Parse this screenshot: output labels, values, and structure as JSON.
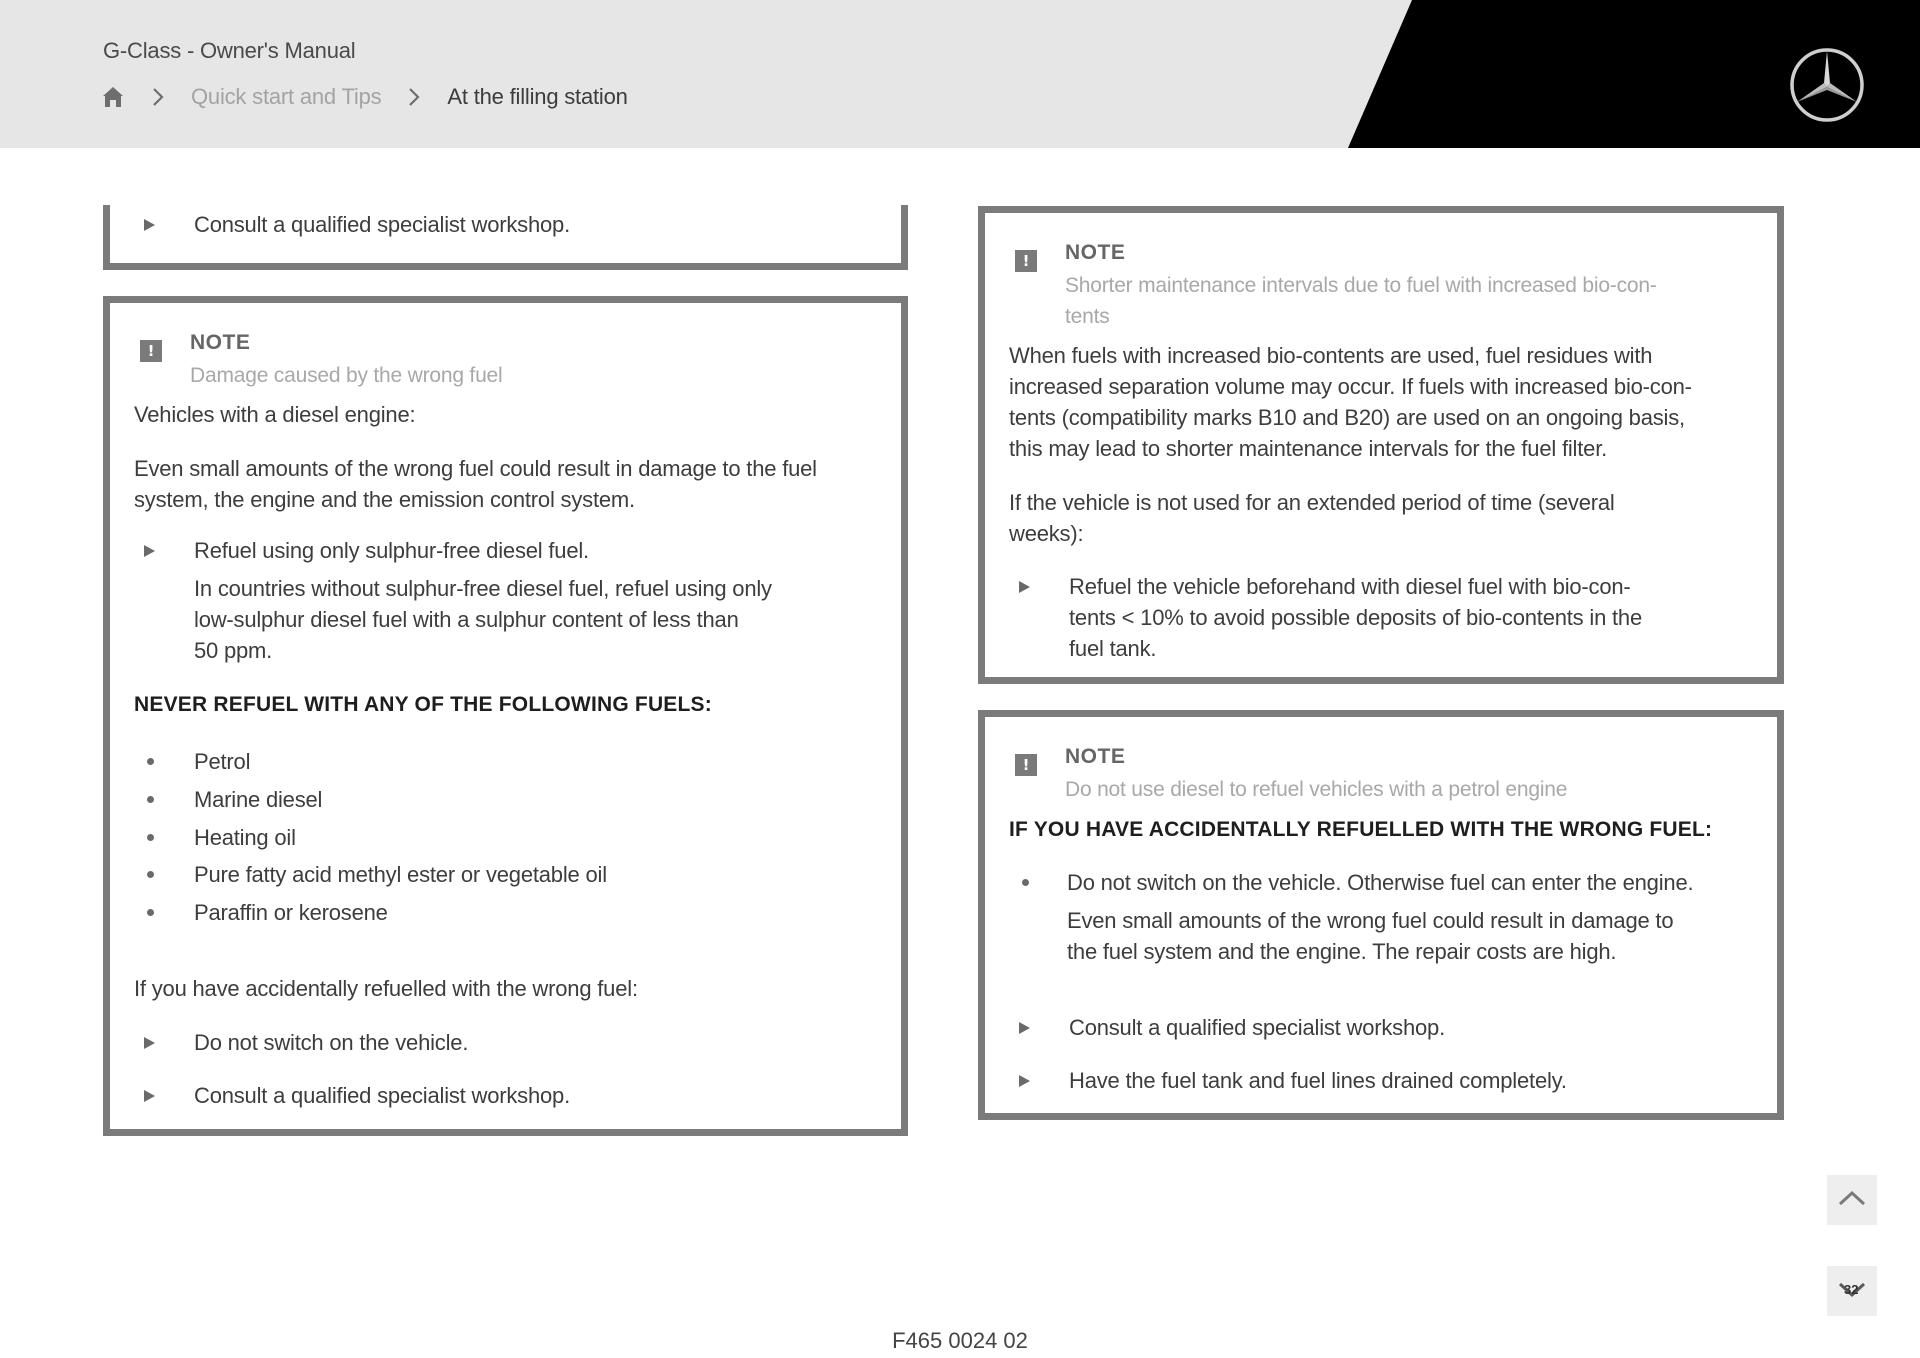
{
  "header": {
    "doc_title": "G-Class - Owner's Manual",
    "breadcrumb": {
      "home_icon": "home-icon",
      "separator_icon": "chevron-right-icon",
      "items": [
        "Quick start and Tips",
        "At the filling station"
      ]
    },
    "logo": "mercedes-star-icon"
  },
  "left_column": {
    "partial_box": {
      "steps": [
        "Consult a qualified specialist workshop."
      ]
    },
    "note_box": {
      "label": "NOTE",
      "subtitle": "Damage caused by the wrong fuel",
      "intro": "Vehicles with a diesel engine:",
      "paragraph": [
        "Even small amounts of the wrong fuel could result in damage to the fuel",
        "system, the engine and the emission control system."
      ],
      "step1": {
        "text": "Refuel using only sulphur-free diesel fuel.",
        "detail": [
          "In countries without sulphur-free diesel fuel, refuel using only",
          "low-sulphur diesel fuel with a sulphur content of less than",
          "50 ppm."
        ]
      },
      "heading": "NEVER REFUEL WITH ANY OF THE FOLLOWING FUELS:",
      "fuels": [
        "Petrol",
        "Marine diesel",
        "Heating oil",
        "Pure fatty acid methyl ester or vegetable oil",
        "Paraffin or kerosene"
      ],
      "if_wrong": "If you have accidentally refuelled with the wrong fuel:",
      "steps": [
        "Do not switch on the vehicle.",
        "Consult a qualified specialist workshop."
      ]
    }
  },
  "right_column": {
    "note_box_1": {
      "label": "NOTE",
      "subtitle": [
        "Shorter maintenance intervals due to fuel with increased bio-con-",
        "tents"
      ],
      "paragraph": [
        "When fuels with increased bio-contents are used, fuel residues with",
        "increased separation volume may occur. If fuels with increased bio-con-",
        "tents (compatibility marks B10 and B20) are used on an ongoing basis,",
        "this may lead to shorter maintenance intervals for the fuel filter."
      ],
      "paragraph2": [
        "If the vehicle is not used for an extended period of time (several",
        "weeks):"
      ],
      "step": [
        "Refuel the vehicle beforehand with diesel fuel with bio-con-",
        "tents < 10% to avoid possible deposits of bio-contents in the",
        "fuel tank."
      ]
    },
    "note_box_2": {
      "label": "NOTE",
      "subtitle": "Do not use diesel to refuel vehicles with a petrol engine",
      "heading": "IF YOU HAVE ACCIDENTALLY REFUELLED WITH THE WRONG FUEL:",
      "bullet": {
        "text": "Do not switch on the vehicle. Otherwise fuel can enter the engine.",
        "detail": [
          "Even small amounts of the wrong fuel could result in damage to",
          "the fuel system and the engine. The repair costs are high."
        ]
      },
      "steps": [
        "Consult a qualified specialist workshop.",
        "Have the fuel tank and fuel lines drained completely."
      ]
    }
  },
  "controls": {
    "scroll_up_icon": "chevron-up-icon",
    "scroll_down_icon": "chevron-down-icon",
    "page_number": "32"
  },
  "footer": {
    "code": "F465 0024 02"
  },
  "colors": {
    "header_bg": "#e6e6e6",
    "brand_black": "#000000",
    "box_border": "#7b7b7b",
    "muted_text": "#a8a8a8"
  }
}
